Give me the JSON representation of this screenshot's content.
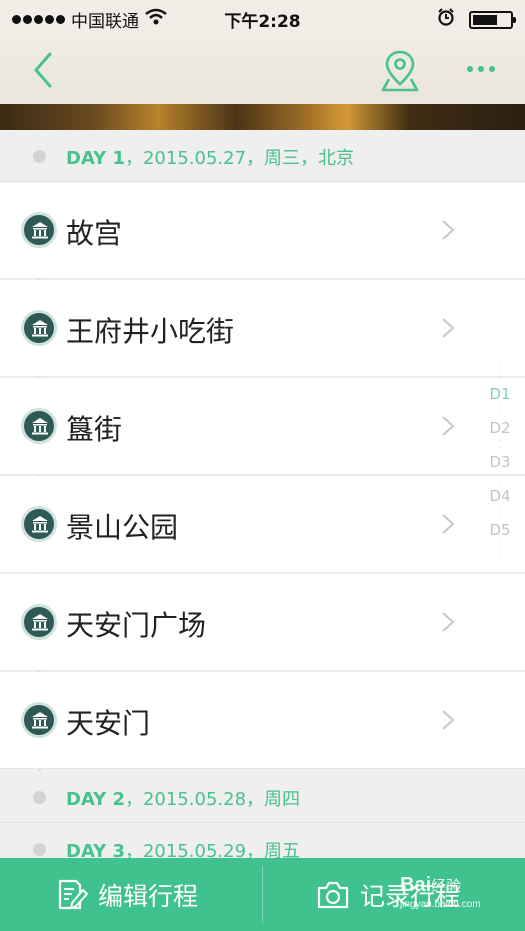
{
  "status_bar": {
    "carrier": "中国联通",
    "time": "下午2:28"
  },
  "nav": {
    "icons": [
      "back-arrow-icon",
      "map-pin-icon",
      "more-dots-icon"
    ],
    "accent_color": "#47c18d"
  },
  "days": [
    {
      "day_label": "DAY 1",
      "details": "，2015.05.27，周三，北京"
    },
    {
      "day_label": "DAY 2",
      "details": "，2015.05.28，周四"
    },
    {
      "day_label": "DAY 3",
      "details": "，2015.05.29，周五"
    }
  ],
  "places": [
    {
      "name": "故宫",
      "icon": "museum-icon"
    },
    {
      "name": "王府井小吃街",
      "icon": "museum-icon"
    },
    {
      "name": "簋街",
      "icon": "museum-icon"
    },
    {
      "name": "景山公园",
      "icon": "museum-icon"
    },
    {
      "name": "天安门广场",
      "icon": "museum-icon"
    },
    {
      "name": "天安门",
      "icon": "museum-icon"
    }
  ],
  "day_index": {
    "items": [
      "D1",
      "D2",
      "D3",
      "D4",
      "D5"
    ],
    "active": "D1"
  },
  "bottom_bar": {
    "edit_label": "编辑行程",
    "record_label": "记录行程",
    "background_color": "#3fc28d"
  },
  "watermark": {
    "brand": "Bai",
    "brand_suffix": "经验",
    "url": "jingyan.baidu.com"
  }
}
